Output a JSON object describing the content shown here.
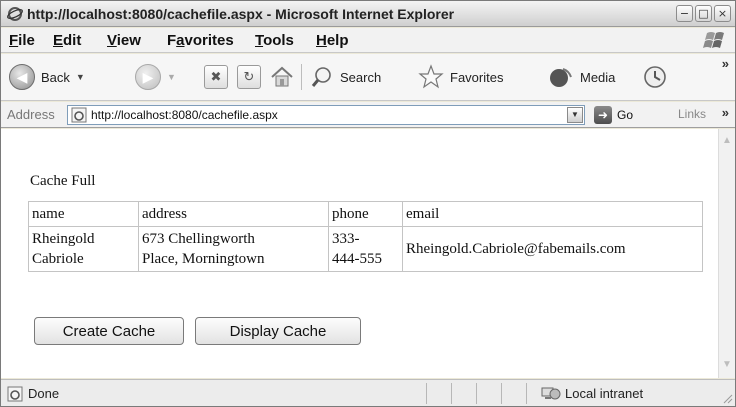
{
  "window": {
    "title": "http://localhost:8080/cachefile.aspx - Microsoft Internet Explorer",
    "controls": {
      "minimize": "−",
      "maximize": "□",
      "close": "×"
    }
  },
  "menu": [
    {
      "accel": "F",
      "rest": "ile"
    },
    {
      "accel": "E",
      "rest": "dit"
    },
    {
      "accel": "V",
      "rest": "iew"
    },
    {
      "pre": "F",
      "accel": "a",
      "rest": "vorites"
    },
    {
      "accel": "T",
      "rest": "ools"
    },
    {
      "accel": "H",
      "rest": "elp"
    }
  ],
  "toolbar": {
    "back_label": "Back",
    "search_label": "Search",
    "favorites_label": "Favorites",
    "media_label": "Media",
    "more": "»",
    "icons": [
      "back-arrow-icon",
      "forward-arrow-icon",
      "stop-icon",
      "refresh-icon",
      "home-icon",
      "search-icon",
      "favorites-star-icon",
      "media-icon",
      "history-icon"
    ]
  },
  "address": {
    "label": "Address",
    "url": "http://localhost:8080/cachefile.aspx",
    "go_label": "Go",
    "links_label": "Links",
    "more": "»"
  },
  "page": {
    "heading": "Cache Full",
    "table": {
      "headers": [
        "name",
        "address",
        "phone",
        "email"
      ],
      "rows": [
        {
          "name": [
            "Rheingold",
            "Cabriole"
          ],
          "address": [
            "673 Chellingworth",
            "Place, Morningtown"
          ],
          "phone": [
            "333-",
            "444-555"
          ],
          "email": "Rheingold.Cabriole@fabemails.com"
        }
      ]
    },
    "buttons": {
      "create": "Create Cache",
      "display": "Display Cache"
    }
  },
  "status": {
    "text": "Done",
    "zone": "Local intranet"
  }
}
